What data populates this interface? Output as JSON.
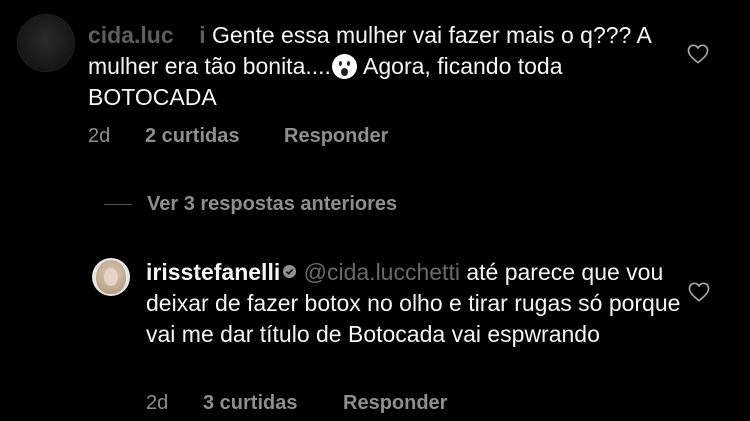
{
  "comments": [
    {
      "username": "cida.luc",
      "username_tail": "i",
      "text_before_emoji": "Gente essa mulher vai fazer mais o q??? A mulher era tão bonita....",
      "emoji": "astonished-face-emoji",
      "text_after_emoji": " Agora, ficando toda BOTOCADA",
      "time": "2d",
      "likes": "2 curtidas",
      "reply_label": "Responder"
    },
    {
      "username": "irisstefanelli",
      "verified": true,
      "mention": "@",
      "mention_obscured": "cida.lucchetti",
      "text": " até parece que vou deixar de fazer botox no olho e tirar rugas só porque vai me dar título de Botocada vai espwrando",
      "time": "2d",
      "likes": "3 curtidas",
      "reply_label": "Responder"
    }
  ],
  "view_replies_label": "Ver 3 respostas anteriores",
  "icons": {
    "like": "heart-outline-icon",
    "verified": "verified-badge-icon"
  },
  "colors": {
    "background": "#000000",
    "text": "#f5f5f5",
    "secondary": "#8e8e8e"
  }
}
